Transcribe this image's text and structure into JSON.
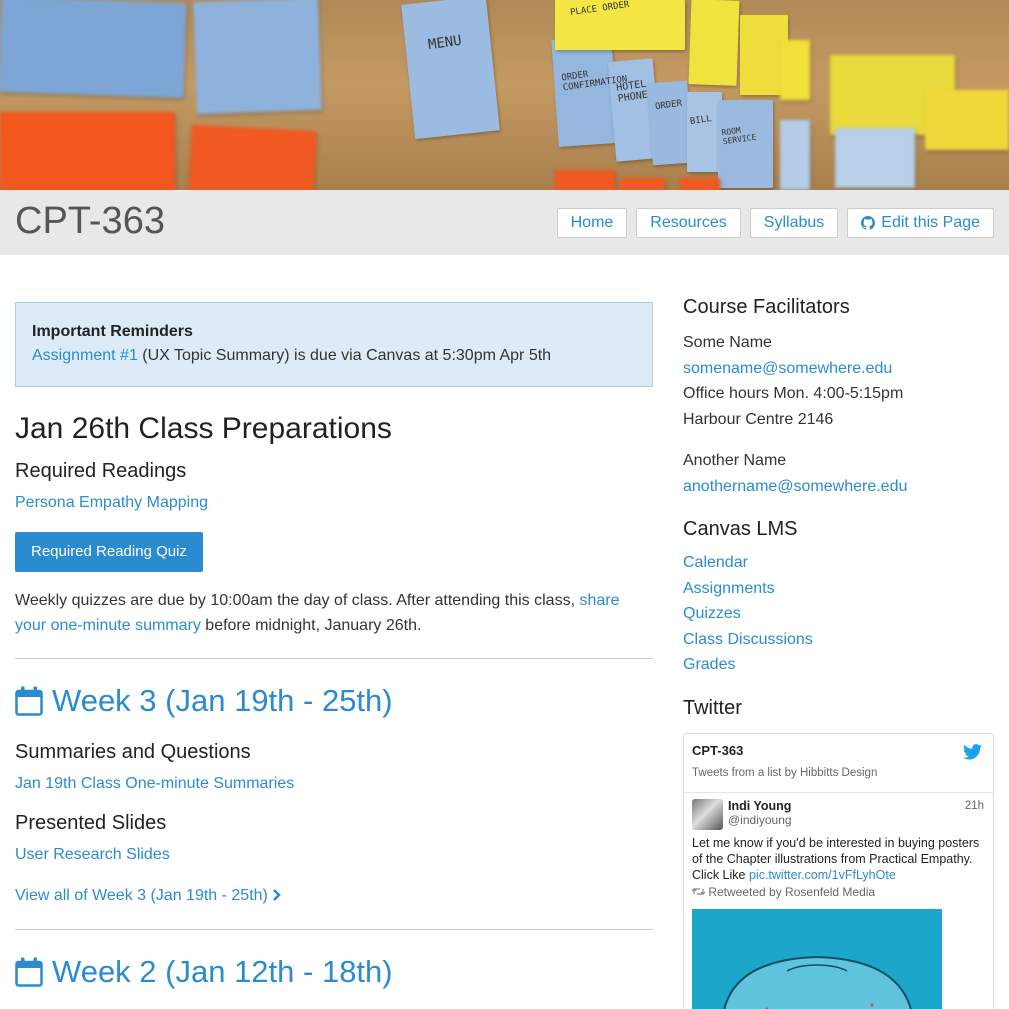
{
  "site": {
    "title": "CPT-363"
  },
  "nav": {
    "home": "Home",
    "resources": "Resources",
    "syllabus": "Syllabus",
    "edit": "Edit this Page"
  },
  "alert": {
    "title": "Important Reminders",
    "link": "Assignment #1",
    "text": " (UX Topic Summary) is due via Canvas at 5:30pm Apr 5th"
  },
  "prep": {
    "title": "Jan 26th Class Preparations",
    "readings_heading": "Required Readings",
    "reading_link": "Persona Empathy Mapping",
    "quiz_button": "Required Reading Quiz",
    "note_before": "Weekly quizzes are due by 10:00am the day of class. After attending this class, ",
    "note_link": "share your one-minute summary",
    "note_after": " before midnight, January 26th."
  },
  "week3": {
    "title": "Week 3 (Jan 19th - 25th)",
    "summaries_heading": "Summaries and Questions",
    "summaries_link": "Jan 19th Class One-minute Summaries",
    "slides_heading": "Presented Slides",
    "slides_link": "User Research Slides",
    "view_all": "View all of Week 3 (Jan 19th - 25th)"
  },
  "week2": {
    "title": "Week 2 (Jan 12th - 18th)"
  },
  "sidebar": {
    "facilitators_heading": "Course Facilitators",
    "f1_name": "Some Name",
    "f1_email": "somename@somewhere.edu",
    "f1_hours": "Office hours Mon. 4:00-5:15pm",
    "f1_room": "Harbour Centre 2146",
    "f2_name": "Another Name",
    "f2_email": "anothername@somewhere.edu",
    "canvas_heading": "Canvas LMS",
    "canvas_links": [
      "Calendar",
      "Assignments",
      "Quizzes",
      "Class Discussions",
      "Grades"
    ],
    "twitter_heading": "Twitter"
  },
  "twitter": {
    "list_name": "CPT-363",
    "list_sub": "Tweets from a list by Hibbitts Design",
    "tweet_author": "Indi Young",
    "tweet_handle": "@indiyoung",
    "tweet_time": "21h",
    "tweet_text": "Let me know if you'd be interested in buying posters of the Chapter illustrations from Practical Empathy. Click Like ",
    "tweet_link": "pic.twitter.com/1vFfLyhOte",
    "retweet": "Retweeted by Rosenfeld Media"
  },
  "banner": {
    "notes": [
      "MENU",
      "ORDER CONFIRMATION",
      "HOTEL PHONE",
      "ORDER",
      "BILL",
      "ROOM SERVICE",
      "PLACE ORDER"
    ]
  },
  "colors": {
    "link": "#2a8bd1",
    "header_bg": "#e8e8e8",
    "alert_bg": "#dcebf7"
  }
}
